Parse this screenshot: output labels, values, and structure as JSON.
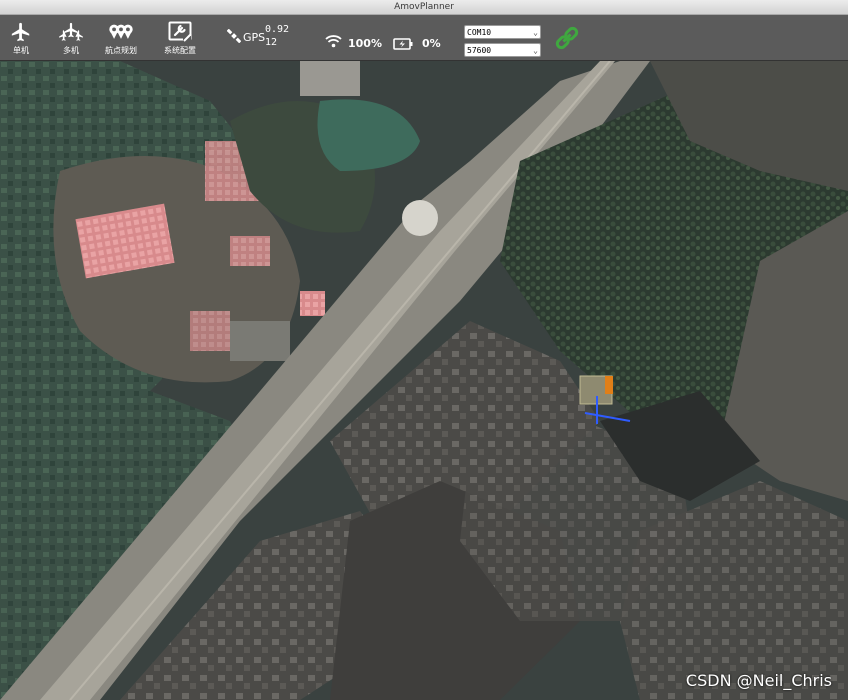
{
  "window": {
    "title": "AmovPlanner"
  },
  "toolbar": {
    "buttons": [
      {
        "label": "单机",
        "icon": "airplane-icon"
      },
      {
        "label": "多机",
        "icon": "multi-airplane-icon"
      },
      {
        "label": "航点规划",
        "icon": "waypoint-icon"
      },
      {
        "label": "系统配置",
        "icon": "settings-icon"
      }
    ],
    "gps": {
      "label": "GPS",
      "hdop": "0.92",
      "satellites": "12"
    },
    "signal": {
      "value": "100%"
    },
    "battery": {
      "value": "0%"
    },
    "port_select": {
      "value": "COM10"
    },
    "baud_select": {
      "value": "57600"
    },
    "connect": {
      "icon": "link-icon",
      "color": "#3fa83f"
    }
  },
  "map": {
    "type": "satellite"
  },
  "watermark": "CSDN @Neil_Chris"
}
